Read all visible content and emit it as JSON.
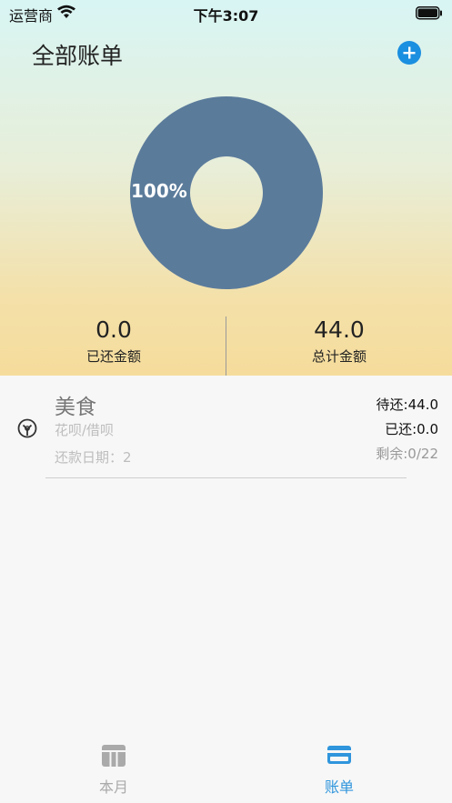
{
  "status_bar": {
    "carrier": "运营商",
    "time": "下午3:07"
  },
  "header": {
    "title": "全部账单"
  },
  "chart_data": {
    "type": "pie",
    "categories": [
      "美食"
    ],
    "values": [
      100
    ],
    "data_label": "100%",
    "colors": [
      "#5b7b9b"
    ]
  },
  "summary": {
    "paid_value": "0.0",
    "paid_label": "已还金额",
    "total_value": "44.0",
    "total_label": "总计金额"
  },
  "bills": [
    {
      "name": "美食",
      "type": "花呗/借呗",
      "date": "还款日期：2",
      "pending": "待还:44.0",
      "paid": "已还:0.0",
      "remaining": "剩余:0/22"
    }
  ],
  "tabs": [
    {
      "label": "本月",
      "icon": "calendar-table-icon",
      "active": false
    },
    {
      "label": "账单",
      "icon": "credit-card-icon",
      "active": true
    }
  ],
  "colors": {
    "accent": "#1b8fe0",
    "tab_active": "#2f95dc",
    "tab_inactive": "#aaaaaa",
    "donut": "#5b7b9b"
  }
}
